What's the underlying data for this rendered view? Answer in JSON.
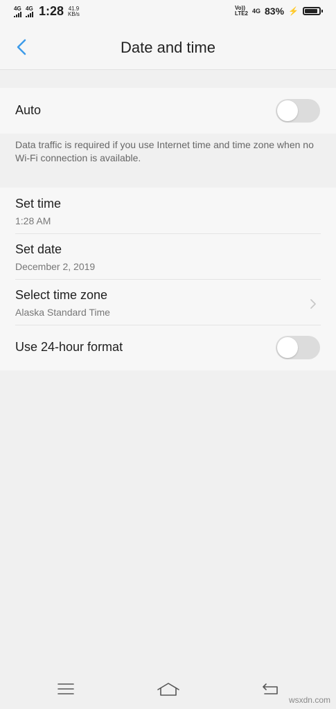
{
  "statusbar": {
    "sim1": "4G",
    "sim2": "4G",
    "time": "1:28",
    "speed_value": "41.9",
    "speed_unit": "KB/s",
    "volte_top": "Vo))",
    "volte_bottom": "LTE2",
    "net": "4G",
    "battery": "83%",
    "battery_level": 0.83
  },
  "header": {
    "title": "Date and time"
  },
  "auto": {
    "label": "Auto",
    "enabled": false
  },
  "note": "Data traffic is required if you use Internet time and time zone when no Wi-Fi connection is available.",
  "items": [
    {
      "label": "Set time",
      "value": "1:28 AM"
    },
    {
      "label": "Set date",
      "value": "December 2, 2019"
    },
    {
      "label": "Select time zone",
      "value": "Alaska Standard Time"
    },
    {
      "label": "Use 24-hour format",
      "enabled": false
    }
  ],
  "icons": {
    "back": "back-arrow-icon",
    "chevron": "chevron-right-icon",
    "menu": "menu-icon",
    "home": "home-icon",
    "return": "return-icon"
  },
  "watermark": "wsxdn.com"
}
